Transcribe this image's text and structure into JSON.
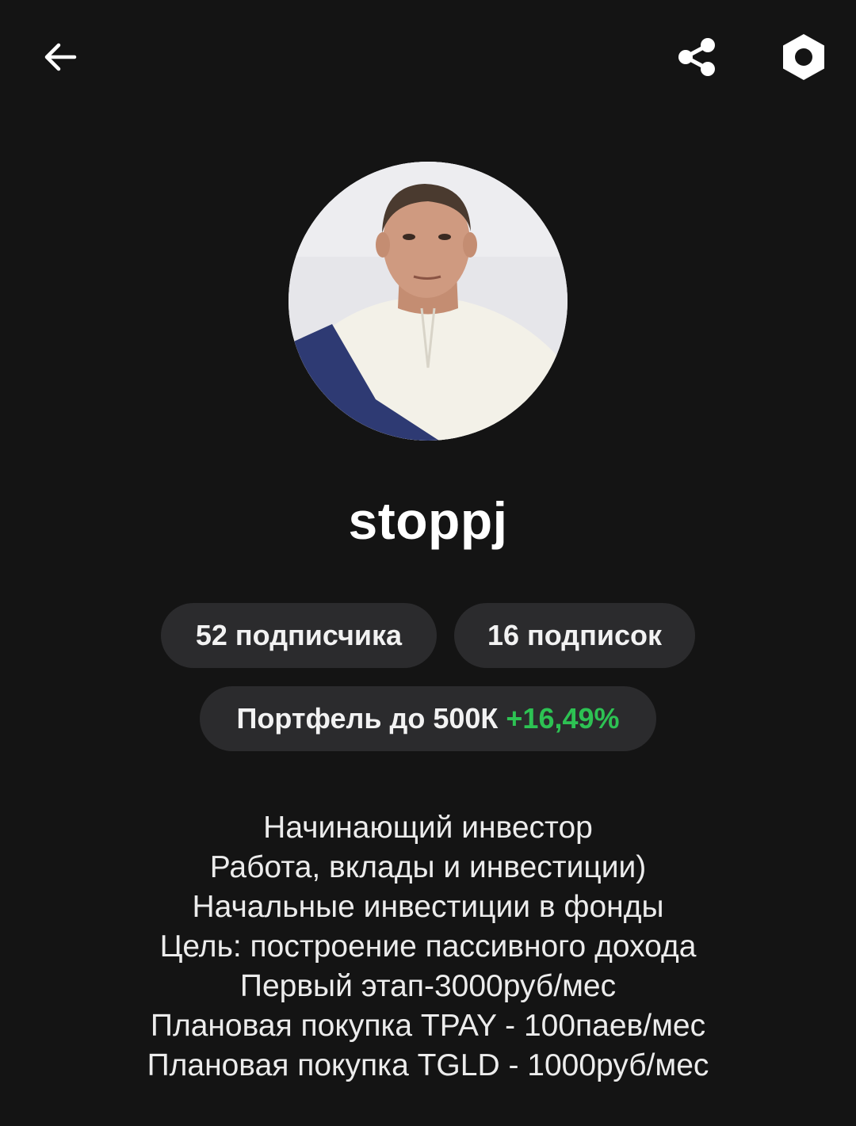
{
  "header": {
    "back_icon": "arrow-left-icon",
    "share_icon": "share-icon",
    "settings_icon": "hexagon-nut-icon"
  },
  "profile": {
    "username": "stoppj",
    "followers_label": "52 подписчика",
    "following_label": "16 подписок",
    "portfolio_label": "Портфель до 500К",
    "portfolio_gain": "+16,49%"
  },
  "bio": {
    "lines": [
      "Начинающий инвестор",
      "Работа, вклады и инвестиции)",
      "Начальные инвестиции в фонды",
      "Цель: построение пассивного дохода",
      "Первый этап-3000руб/мес",
      "Плановая покупка TPAY - 100паев/мес",
      "Плановая покупка TGLD - 1000руб/мес"
    ]
  },
  "colors": {
    "background": "#141414",
    "pill": "#2b2b2d",
    "gain": "#2dc253",
    "text": "#ffffff"
  }
}
